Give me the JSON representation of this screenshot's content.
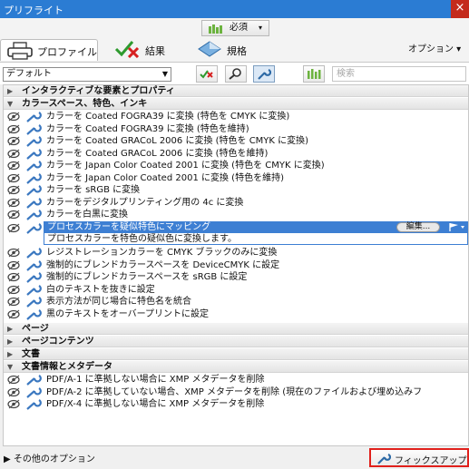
{
  "window": {
    "title": "プリフライト",
    "close": "×"
  },
  "top": {
    "must_label": "必須",
    "caret": "▾"
  },
  "tabs": [
    {
      "label": "プロファイル"
    },
    {
      "label": "結果"
    },
    {
      "label": "規格"
    }
  ],
  "options_label": "オプション ▾",
  "filter": {
    "profile_value": "デフォルト",
    "search_placeholder": "検索"
  },
  "tree": {
    "interactive": "インタラクティブな要素とプロパティ",
    "colorspace": "カラースペース、特色、インキ",
    "items": [
      "カラーを Coated FOGRA39 に変換 (特色を CMYK に変換)",
      "カラーを Coated FOGRA39 に変換 (特色を維持)",
      "カラーを Coated GRACoL 2006 に変換 (特色を CMYK に変換)",
      "カラーを Coated GRACoL 2006 に変換 (特色を維持)",
      "カラーを Japan Color Coated 2001 に変換 (特色を CMYK に変換)",
      "カラーを Japan Color Coated 2001 に変換 (特色を維持)",
      "カラーを sRGB に変換",
      "カラーをデジタルプリンティング用の 4c に変換",
      "カラーを白黒に変換"
    ],
    "selected": {
      "title": "プロセスカラーを疑似特色にマッピング",
      "description": "プロセスカラーを特色の疑似色に変換します。",
      "edit": "編集..."
    },
    "items2": [
      "レジストレーションカラーを CMYK ブラックのみに変換",
      "強制的にブレンドカラースペースを DeviceCMYK に設定",
      "強制的にブレンドカラースペースを sRGB に設定",
      "白のテキストを抜きに設定",
      "表示方法が同じ場合に特色名を統合",
      "黒のテキストをオーバープリントに設定"
    ],
    "page": "ページ",
    "page_content": "ページコンテンツ",
    "document": "文書",
    "doc_info": "文書情報とメタデータ",
    "items3": [
      "PDF/A-1 に準拠しない場合に XMP メタデータを削除",
      "PDF/A-2 に準拠していない場合、XMP メタデータを削除 (現在のファイルおよび埋め込みフ",
      "PDF/X-4 に準拠しない場合に XMP メタデータを削除"
    ]
  },
  "footer": {
    "more_options": "その他のオプション",
    "fixup": "フィックスアップ"
  }
}
